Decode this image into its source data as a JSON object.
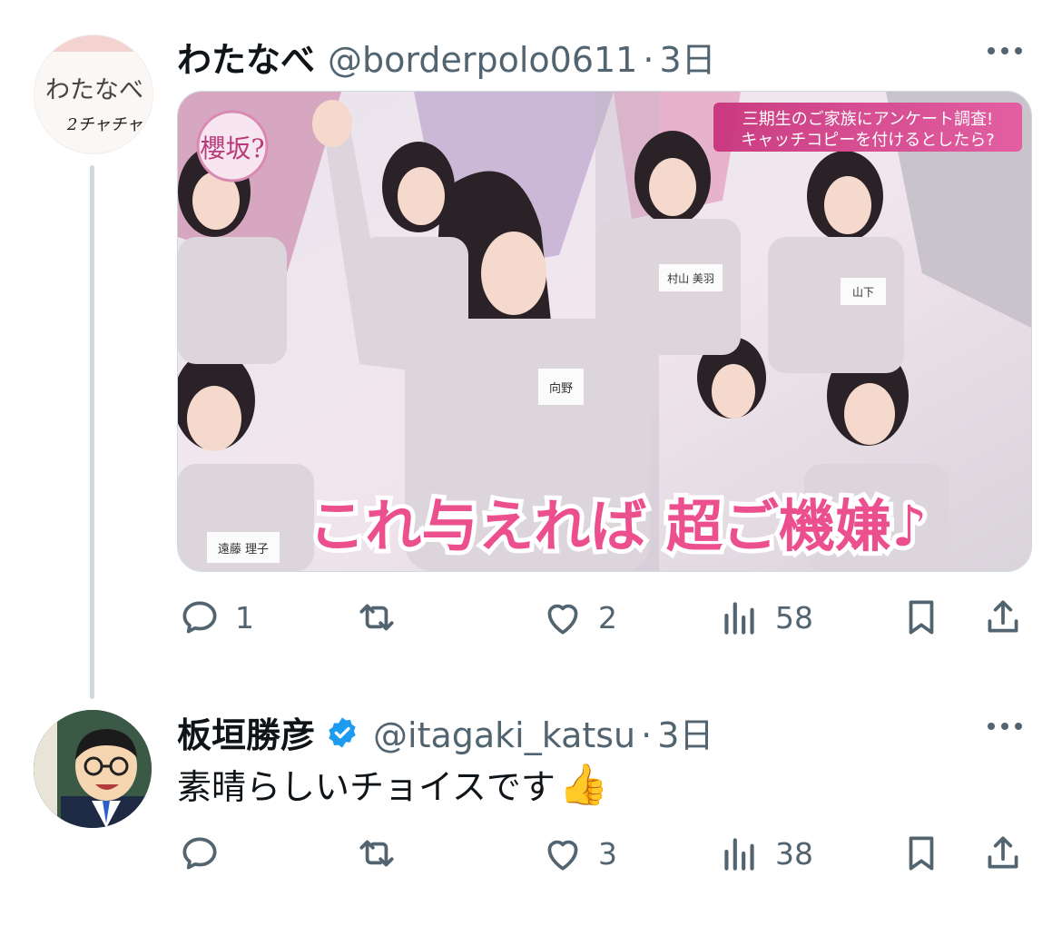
{
  "tweet1": {
    "avatar_text_line1": "わたなべ",
    "avatar_text_line2": "2チャチャ",
    "name": "わたなべ",
    "handle": "@borderpolo0611",
    "separator": "·",
    "time": "3日",
    "media": {
      "logo_text": "櫻坂?",
      "caption_line1": "三期生のご家族にアンケート調査!",
      "caption_line2": "キャッチコピーを付けるとしたら?",
      "subtitle": "これ与えれば 超ご機嫌♪",
      "name_tags": [
        "向野",
        "遠藤 理子",
        "村山 美羽",
        "山下"
      ]
    },
    "actions": {
      "replies": "1",
      "retweets": "",
      "likes": "2",
      "views": "58"
    }
  },
  "tweet2": {
    "name": "板垣勝彦",
    "handle": "@itagaki_katsu",
    "separator": "·",
    "time": "3日",
    "text": "素晴らしいチョイスです",
    "emoji": "👍",
    "actions": {
      "replies": "",
      "retweets": "",
      "likes": "3",
      "views": "38"
    }
  },
  "colors": {
    "text_primary": "#0f1419",
    "text_secondary": "#536471",
    "verified_blue": "#1d9bf0",
    "thread_line": "#cfd9de"
  },
  "icons": [
    "reply-icon",
    "retweet-icon",
    "like-icon",
    "views-icon",
    "bookmark-icon",
    "share-icon",
    "more-icon",
    "verified-badge-icon"
  ]
}
